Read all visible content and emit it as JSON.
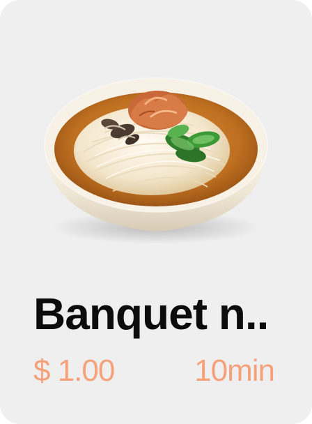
{
  "card": {
    "title": "Banquet n..",
    "price": "$ 1.00",
    "time": "10min",
    "image_icon": "noodle-soup-bowl-icon"
  },
  "colors": {
    "card_background": "#f0efef",
    "title": "#0c0c0c",
    "accent": "#f4a27a"
  }
}
